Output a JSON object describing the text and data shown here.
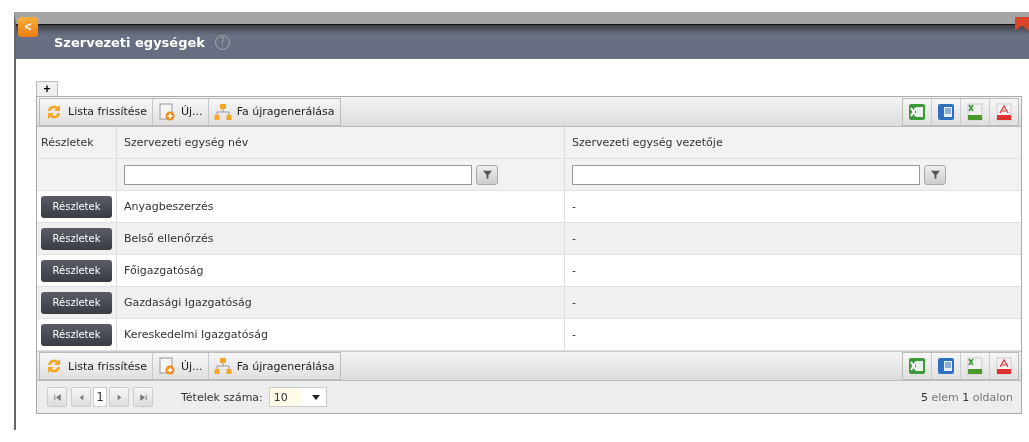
{
  "window": {
    "title": "Szervezeti egységek",
    "back_button": "<",
    "help": "?"
  },
  "add_tab": "+",
  "top_toolbar": [
    "Lista frissítése",
    "Új...",
    "Fa újragenerálása"
  ],
  "table": {
    "columns": [
      "Részletek",
      "Szervezeti egység név",
      "Szervezeti egység vezetője"
    ],
    "rows": [
      {
        "details": "Részletek",
        "name": "Anyagbeszerzés",
        "leader": "-"
      },
      {
        "details": "Részletek",
        "name": "Belső ellenőrzés",
        "leader": "-"
      },
      {
        "details": "Részletek",
        "name": "Főigazgatóság",
        "leader": "-"
      },
      {
        "details": "Részletek",
        "name": "Gazdasági Igazgatóság",
        "leader": "-"
      },
      {
        "details": "Részletek",
        "name": "Kereskedelmi Igazgatóság",
        "leader": "-"
      }
    ]
  },
  "bottom_toolbar": [
    "Lista frissítése",
    "Új...",
    "Fa újragenerálása"
  ],
  "pager": {
    "page": "1",
    "page_size_label": "Tételek száma:",
    "page_size": "10",
    "summary": "**5** elem **1** oldalon"
  }
}
